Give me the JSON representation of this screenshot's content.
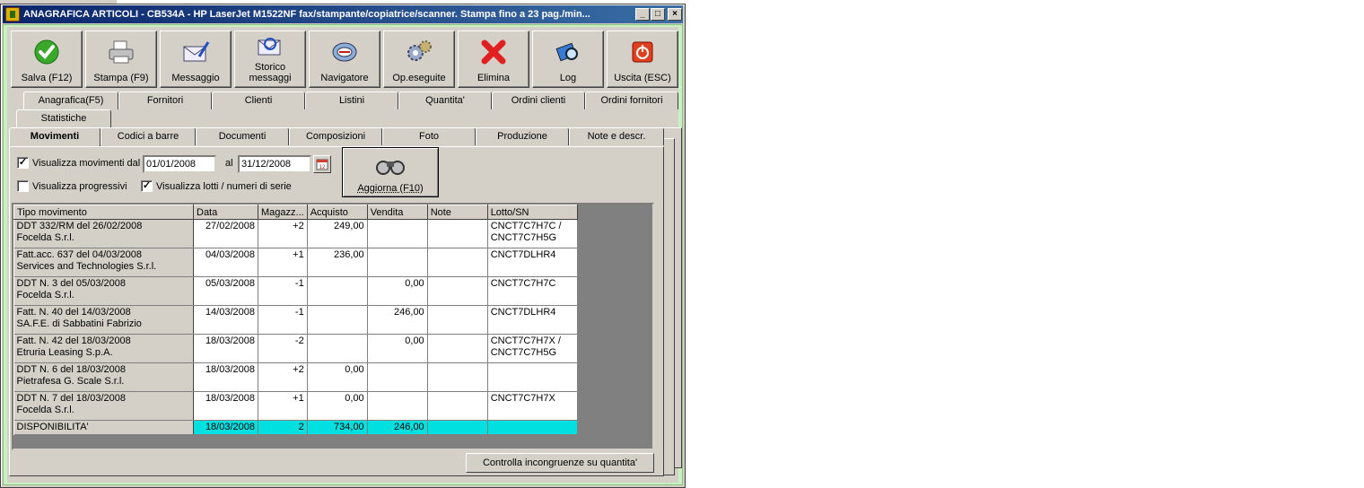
{
  "window": {
    "title": "ANAGRAFICA ARTICOLI - CB534A - HP LaserJet M1522NF fax/stampante/copiatrice/scanner. Stampa fino a 23 pag./min...",
    "min": "_",
    "max": "□",
    "close": "×"
  },
  "toolbar": [
    {
      "label": "Salva (F12)",
      "icon": "check-icon"
    },
    {
      "label": "Stampa (F9)",
      "icon": "printer-icon"
    },
    {
      "label": "Messaggio",
      "icon": "envelope-pen-icon"
    },
    {
      "label": "Storico messaggi",
      "icon": "envelope-search-icon"
    },
    {
      "label": "Navigatore",
      "icon": "compass-icon"
    },
    {
      "label": "Op.eseguite",
      "icon": "gears-icon"
    },
    {
      "label": "Elimina",
      "icon": "red-x-icon"
    },
    {
      "label": "Log",
      "icon": "log-search-icon"
    },
    {
      "label": "Uscita (ESC)",
      "icon": "exit-icon"
    }
  ],
  "tabs_row1": [
    "Anagrafica(F5)",
    "Fornitori",
    "Clienti",
    "Listini",
    "Quantita'",
    "Ordini clienti",
    "Ordini fornitori"
  ],
  "tabs_row2": [
    "Statistiche"
  ],
  "tabs_row3": [
    "Movimenti",
    "Codici a barre",
    "Documenti",
    "Composizioni",
    "Foto",
    "Produzione",
    "Note e descr."
  ],
  "filters": {
    "show_movements_label": "Visualizza movimenti dal",
    "show_movements_checked": true,
    "date_from": "01/01/2008",
    "al_label": "al",
    "date_to": "31/12/2008",
    "progressive_label": "Visualizza progressivi",
    "progressive_checked": false,
    "lots_label": "Visualizza lotti /  numeri di serie",
    "lots_checked": true,
    "refresh_label": "Aggiorna (F10)"
  },
  "grid": {
    "columns": [
      "Tipo movimento",
      "Data",
      "Magazz...",
      "Acquisto",
      "Vendita",
      "Note",
      "Lotto/SN"
    ],
    "rows": [
      {
        "tipo1": "DDT 332/RM del 26/02/2008",
        "tipo2": "Focelda S.r.l.",
        "data": "27/02/2008",
        "mag": "+2",
        "acq": "249,00",
        "ven": "",
        "note": "",
        "lotto1": "CNCT7C7H7C /",
        "lotto2": "CNCT7C7H5G"
      },
      {
        "tipo1": "Fatt.acc. 637 del 04/03/2008",
        "tipo2": "Services and Technologies S.r.l.",
        "data": "04/03/2008",
        "mag": "+1",
        "acq": "236,00",
        "ven": "",
        "note": "",
        "lotto1": "CNCT7DLHR4",
        "lotto2": ""
      },
      {
        "tipo1": "DDT N. 3 del 05/03/2008",
        "tipo2": "Focelda S.r.l.",
        "data": "05/03/2008",
        "mag": "-1",
        "acq": "",
        "ven": "0,00",
        "note": "",
        "lotto1": "CNCT7C7H7C",
        "lotto2": ""
      },
      {
        "tipo1": "Fatt. N. 40 del 14/03/2008",
        "tipo2": "SA.F.E. di Sabbatini Fabrizio",
        "data": "14/03/2008",
        "mag": "-1",
        "acq": "",
        "ven": "246,00",
        "note": "",
        "lotto1": "CNCT7DLHR4",
        "lotto2": ""
      },
      {
        "tipo1": "Fatt. N. 42 del 18/03/2008",
        "tipo2": "Etruria Leasing S.p.A.",
        "data": "18/03/2008",
        "mag": "-2",
        "acq": "",
        "ven": "0,00",
        "note": "",
        "lotto1": "CNCT7C7H7X /",
        "lotto2": "CNCT7C7H5G"
      },
      {
        "tipo1": "DDT N. 6 del 18/03/2008",
        "tipo2": "Pietrafesa G. Scale S.r.l.",
        "data": "18/03/2008",
        "mag": "+2",
        "acq": "0,00",
        "ven": "",
        "note": "",
        "lotto1": "",
        "lotto2": ""
      },
      {
        "tipo1": "DDT N. 7 del 18/03/2008",
        "tipo2": "Focelda S.r.l.",
        "data": "18/03/2008",
        "mag": "+1",
        "acq": "0,00",
        "ven": "",
        "note": "",
        "lotto1": "CNCT7C7H7X",
        "lotto2": ""
      }
    ],
    "total": {
      "tipo": "DISPONIBILITA'",
      "data": "18/03/2008",
      "mag": "2",
      "acq": "734,00",
      "ven": "246,00",
      "note": "",
      "lotto": ""
    }
  },
  "check_button": "Controlla incongruenze su quantita'",
  "colors": {
    "title_bar": "#0a246a",
    "frame": "#c8f0c0",
    "total_row": "#00e0e0",
    "face": "#d4d0c8"
  }
}
